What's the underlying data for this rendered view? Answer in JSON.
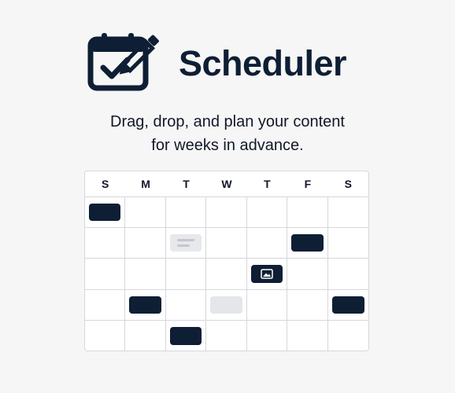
{
  "brand": {
    "title": "Scheduler",
    "logo_icon": "calendar-check-pencil-icon"
  },
  "tagline": {
    "line1": "Drag, drop, and plan your content",
    "line2": "for weeks in advance."
  },
  "calendar": {
    "days": [
      "S",
      "M",
      "T",
      "W",
      "T",
      "F",
      "S"
    ],
    "rows": 5,
    "events": [
      {
        "row": 0,
        "col": 0,
        "style": "dark"
      },
      {
        "row": 1,
        "col": 2,
        "style": "light",
        "icon": "text-lines-icon"
      },
      {
        "row": 1,
        "col": 5,
        "style": "dark"
      },
      {
        "row": 2,
        "col": 4,
        "style": "dark",
        "icon": "image-icon"
      },
      {
        "row": 3,
        "col": 1,
        "style": "dark"
      },
      {
        "row": 3,
        "col": 3,
        "style": "light"
      },
      {
        "row": 3,
        "col": 6,
        "style": "dark"
      },
      {
        "row": 4,
        "col": 2,
        "style": "dark"
      }
    ]
  },
  "colors": {
    "navy": "#0e1e34",
    "light_chip": "#e4e6e9",
    "grid_line": "#d5d7db"
  }
}
